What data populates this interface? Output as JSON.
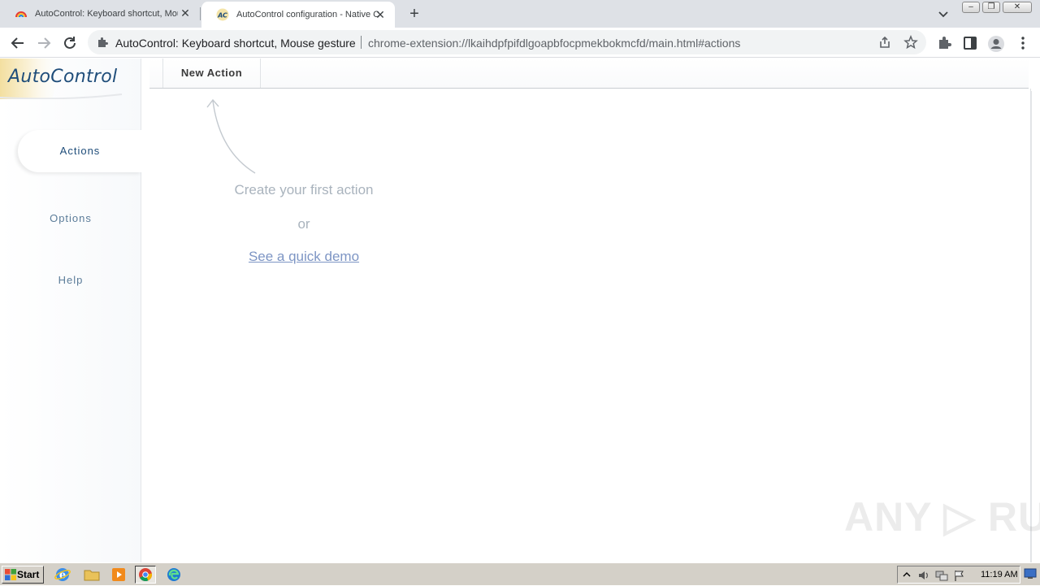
{
  "browser": {
    "tabs": [
      {
        "title": "AutoControl: Keyboard shortcut, Mouse gesture",
        "active": false,
        "close": "✕"
      },
      {
        "title": "AutoControl configuration - Native Client",
        "active": true,
        "close": "✕"
      }
    ],
    "new_tab": "+",
    "window_controls": {
      "minimize": "–",
      "restore": "❐",
      "close": "✕"
    },
    "omnibox": {
      "site_name": "AutoControl: Keyboard shortcut, Mouse gesture",
      "url": "chrome-extension://lkaihdpfpifdlgoapbfocpmekbokmcfd/main.html#actions"
    }
  },
  "app": {
    "logo": "AutoControl",
    "nav": {
      "actions": "Actions",
      "options": "Options",
      "help": "Help"
    },
    "toolbar": {
      "new_action": "New Action"
    },
    "empty_state": {
      "create": "Create your first action",
      "or": "or",
      "demo_link": "See a quick demo"
    }
  },
  "watermark": "ANY ▷ RUN",
  "taskbar": {
    "start": "Start",
    "clock": "11:19 AM"
  },
  "colors": {
    "accent_blue": "#1f4d7a",
    "nav_text": "#5b7c99",
    "hint_text": "#a9b3bd",
    "link": "#7d95c4"
  }
}
